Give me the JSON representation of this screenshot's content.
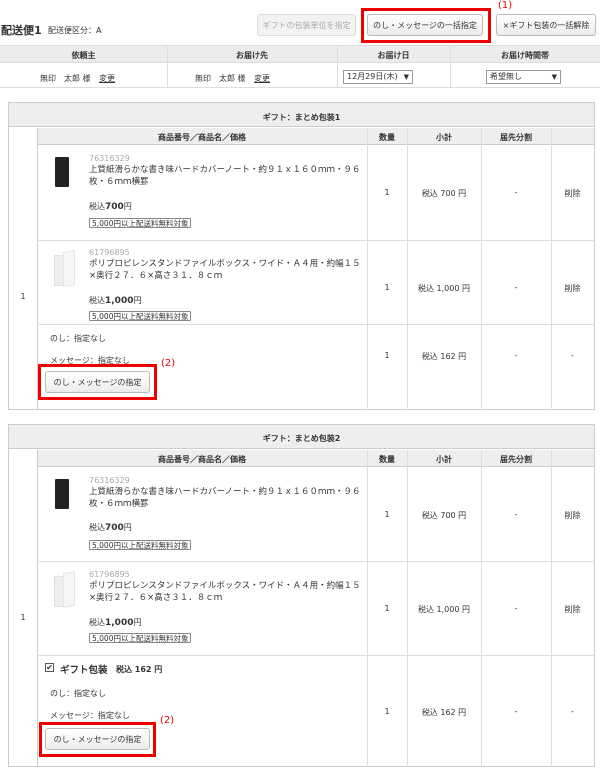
{
  "header": {
    "title": "配送便1",
    "subtitle": "配送便区分：A",
    "btn_gift_unit": "ギフトの包装単位を指定",
    "btn_noshi_bulk": "のし・メッセージの一括指定",
    "btn_gift_cancel": "×ギフト包装の一括解除",
    "annot_1": "(1)",
    "annot_2": "(2)"
  },
  "shipping_header": {
    "col_sender": "依頼主",
    "col_recipient": "お届け先",
    "col_date": "お届け日",
    "col_time": "お届け時間帯",
    "sender_value": "無印　太郎 様",
    "recipient_value": "無印　太郎 様",
    "change_link": "変更",
    "date_value": "12月29日(木)",
    "time_value": "希望無し"
  },
  "table_headers": {
    "product": "商品番号／商品名／価格",
    "qty": "数量",
    "subtotal": "小計",
    "split": "届先分割"
  },
  "group1": {
    "title": "ギフト：まとめ包装1",
    "row_no": "1",
    "items": [
      {
        "sku": "76316329",
        "name_l1": "上質紙滑らかな書き味ハードカバーノート・約９１ｘ１６０ｍｍ・９６",
        "name_l2": "枚・６ｍｍ横罫",
        "price_prefix": "税込",
        "price": "700",
        "price_suffix": "円",
        "badge": "5,000円以上配送料無料対象",
        "qty": "1",
        "subtotal": "税込 700 円",
        "split": "-",
        "delete": "削除"
      },
      {
        "sku": "61796895",
        "name_l1": "ポリプロピレンスタンドファイルボックス・ワイド・Ａ４用・約幅１５",
        "name_l2": "×奥行２７．６×高さ３１．８ｃｍ",
        "price_prefix": "税込",
        "price": "1,000",
        "price_suffix": "円",
        "badge": "5,000円以上配送料無料対象",
        "qty": "1",
        "subtotal": "税込 1,000 円",
        "split": "-",
        "delete": "削除"
      }
    ],
    "noshi": "のし：指定なし",
    "message": "メッセージ：指定なし",
    "wrap_qty": "1",
    "wrap_subtotal": "税込 162 円",
    "wrap_split": "-",
    "wrap_delete": "-",
    "btn_noshi": "のし・メッセージの指定"
  },
  "group2": {
    "title": "ギフト：まとめ包装2",
    "row_no": "1",
    "items": [
      {
        "sku": "76316329",
        "name_l1": "上質紙滑らかな書き味ハードカバーノート・約９１ｘ１６０ｍｍ・９６",
        "name_l2": "枚・６ｍｍ横罫",
        "price_prefix": "税込",
        "price": "700",
        "price_suffix": "円",
        "badge": "5,000円以上配送料無料対象",
        "qty": "1",
        "subtotal": "税込 700 円",
        "split": "-",
        "delete": "削除"
      },
      {
        "sku": "61796895",
        "name_l1": "ポリプロピレンスタンドファイルボックス・ワイド・Ａ４用・約幅１５",
        "name_l2": "×奥行２７．６×高さ３１．８ｃｍ",
        "price_prefix": "税込",
        "price": "1,000",
        "price_suffix": "円",
        "badge": "5,000円以上配送料無料対象",
        "qty": "1",
        "subtotal": "税込 1,000 円",
        "split": "-",
        "delete": "削除"
      }
    ],
    "gift_wrap_label": "ギフト包装",
    "gift_wrap_price": "税込 162 円",
    "noshi": "のし：指定なし",
    "message": "メッセージ：指定なし",
    "wrap_qty": "1",
    "wrap_subtotal": "税込 162 円",
    "wrap_split": "-",
    "wrap_delete": "-",
    "btn_noshi": "のし・メッセージの指定"
  }
}
